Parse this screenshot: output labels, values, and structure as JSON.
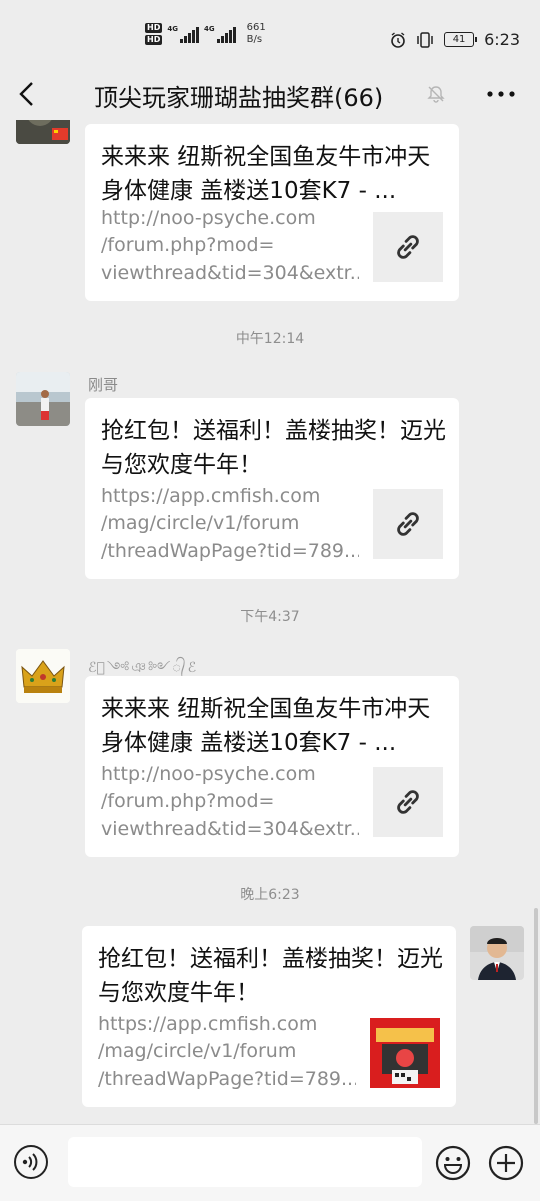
{
  "status_bar": {
    "hd1": "HD",
    "hd2": "HD",
    "net1": "4G",
    "net2": "4G",
    "speed_value": "661",
    "speed_unit": "B/s",
    "battery": "41",
    "time": "6:23"
  },
  "nav": {
    "title": "顶尖玩家珊瑚盐抽奖群(66)",
    "back_icon": "chevron-left-icon",
    "mute_icon": "bell-off-icon",
    "more_icon": "more-dots-icon"
  },
  "messages": [
    {
      "card_title": "来来来 纽斯祝全国鱼友牛市冲天 身体健康 盖楼送10套K7 - ...",
      "url_lines": [
        "http://noo-psyche.com",
        "/forum.php?mod=",
        "viewthread&tid=304&extr..."
      ]
    },
    {
      "timestamp": "中午12:14",
      "sender": "刚哥",
      "card_title": "抢红包！送福利！盖楼抽奖！迈光与您欢度牛年！",
      "url_lines": [
        "https://app.cmfish.com",
        "/mag/circle/v1/forum",
        "/threadWapPage?tid=789..."
      ]
    },
    {
      "timestamp": "下午4:37",
      "sender": "ℰ᭄༺ঞ༻᭄ℰ",
      "card_title": "来来来 纽斯祝全国鱼友牛市冲天 身体健康 盖楼送10套K7 - ...",
      "url_lines": [
        "http://noo-psyche.com",
        "/forum.php?mod=",
        "viewthread&tid=304&extr..."
      ]
    },
    {
      "timestamp": "晚上6:23",
      "card_title": "抢红包！送福利！盖楼抽奖！迈光与您欢度牛年！",
      "url_lines": [
        "https://app.cmfish.com",
        "/mag/circle/v1/forum",
        "/threadWapPage?tid=789..."
      ]
    }
  ],
  "input_bar": {
    "voice_icon": "voice-icon",
    "emoji_icon": "emoji-icon",
    "plus_icon": "plus-icon"
  }
}
